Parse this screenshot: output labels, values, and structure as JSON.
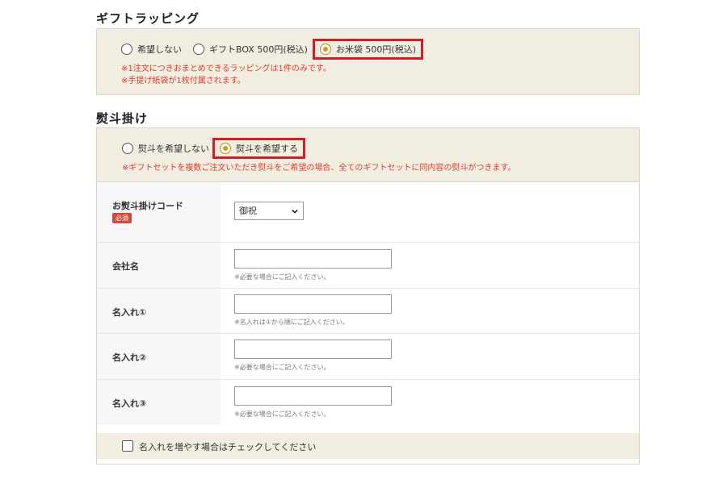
{
  "gift_wrapping": {
    "title": "ギフトラッピング",
    "options": [
      {
        "label": "希望しない",
        "selected": false
      },
      {
        "label": "ギフトBOX 500円(税込)",
        "selected": false
      },
      {
        "label": "お米袋 500円(税込)",
        "selected": true
      }
    ],
    "notes": [
      "※1注文につきおまとめできるラッピングは1件のみです。",
      "※手提げ紙袋が1枚付属されます。"
    ]
  },
  "noshi": {
    "title": "熨斗掛け",
    "options": [
      {
        "label": "熨斗を希望しない",
        "selected": false
      },
      {
        "label": "熨斗を希望する",
        "selected": true
      }
    ],
    "note": "※ギフトセットを複数ご注文いただき熨斗をご希望の場合、全てのギフトセットに同内容の熨斗がつきます。",
    "code": {
      "label": "お熨斗掛けコード",
      "required_badge": "必須",
      "selected": "御祝"
    },
    "fields": [
      {
        "label": "会社名",
        "value": "",
        "hint": "※必要な場合にご記入ください。"
      },
      {
        "label": "名入れ①",
        "value": "",
        "hint": "※名入れは①から順にご記入ください。"
      },
      {
        "label": "名入れ②",
        "value": "",
        "hint": "※必要な場合にご記入ください。"
      },
      {
        "label": "名入れ③",
        "value": "",
        "hint": "※必要な場合にご記入ください。"
      }
    ],
    "add_names_label": "名入れを増やす場合はチェックしてください"
  },
  "colors": {
    "beige": "#f1ede1",
    "highlight_red": "#d11f26",
    "note_red": "#e03a2c",
    "radio_selected": "#d9951f"
  }
}
